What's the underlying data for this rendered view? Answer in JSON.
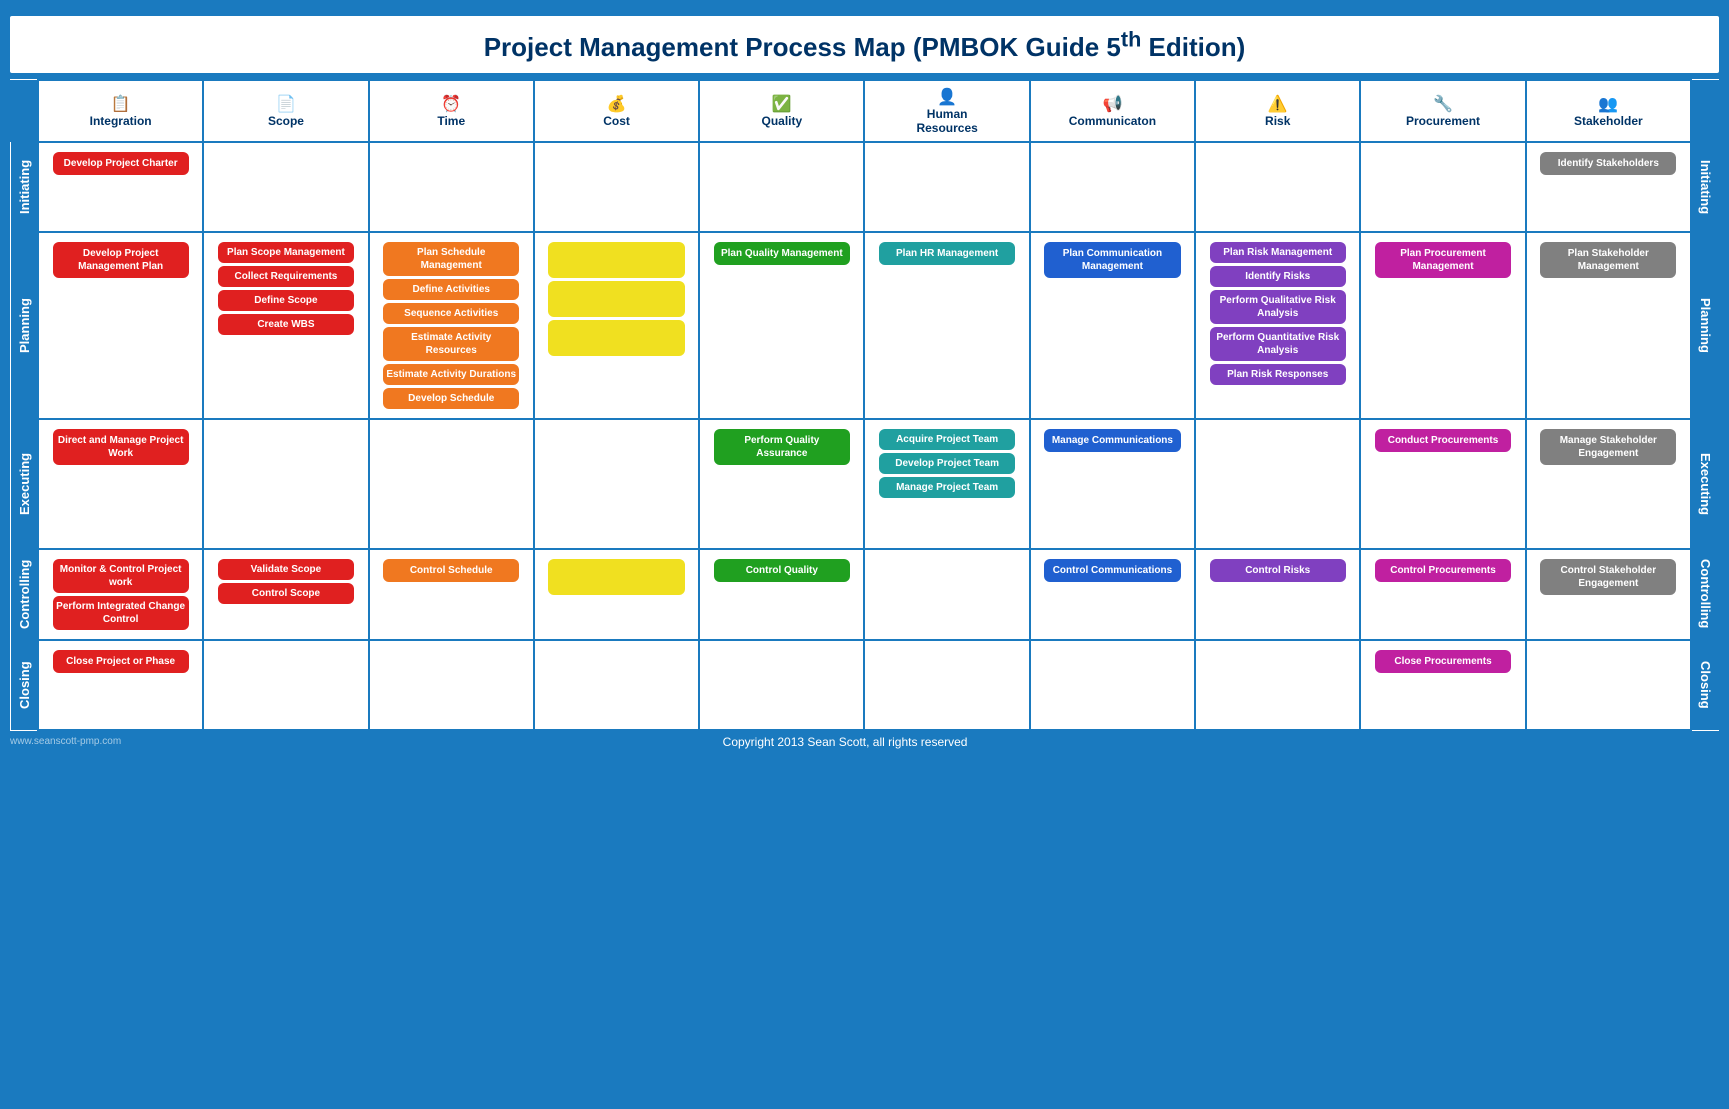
{
  "title": {
    "main": "Project Management Process Map (PMBOK Guide 5",
    "sup": "th",
    "main2": " Edition)"
  },
  "columns": [
    {
      "label": "Integration",
      "icon": "📋"
    },
    {
      "label": "Scope",
      "icon": "📋"
    },
    {
      "label": "Time",
      "icon": "⏰"
    },
    {
      "label": "Cost",
      "icon": "💰"
    },
    {
      "label": "Quality",
      "icon": "✅"
    },
    {
      "label": "Human\nResources",
      "icon": "👤"
    },
    {
      "label": "Communicaton",
      "icon": "📢"
    },
    {
      "label": "Risk",
      "icon": "⚠️"
    },
    {
      "label": "Procurement",
      "icon": "🔧"
    },
    {
      "label": "Stakeholder",
      "icon": "👥"
    }
  ],
  "phases": [
    {
      "name": "Initiating",
      "rows": 1,
      "cells": [
        {
          "col": 0,
          "boxes": [
            {
              "text": "Develop Project Charter",
              "color": "red"
            }
          ]
        },
        {
          "col": 1,
          "boxes": []
        },
        {
          "col": 2,
          "boxes": []
        },
        {
          "col": 3,
          "boxes": []
        },
        {
          "col": 4,
          "boxes": []
        },
        {
          "col": 5,
          "boxes": []
        },
        {
          "col": 6,
          "boxes": []
        },
        {
          "col": 7,
          "boxes": []
        },
        {
          "col": 8,
          "boxes": []
        },
        {
          "col": 9,
          "boxes": [
            {
              "text": "Identify Stakeholders",
              "color": "gray"
            }
          ]
        }
      ]
    },
    {
      "name": "Planning",
      "rows": 6,
      "cells": [
        {
          "col": 0,
          "boxes": [
            {
              "text": "Develop Project Management Plan",
              "color": "red"
            }
          ]
        },
        {
          "col": 1,
          "boxes": [
            {
              "text": "Plan Scope Management",
              "color": "red"
            },
            {
              "text": "Collect Requirements",
              "color": "red"
            },
            {
              "text": "Define Scope",
              "color": "red"
            },
            {
              "text": "Create WBS",
              "color": "red"
            }
          ]
        },
        {
          "col": 2,
          "boxes": [
            {
              "text": "Plan Schedule Management",
              "color": "orange"
            },
            {
              "text": "Define Activities",
              "color": "orange"
            },
            {
              "text": "Sequence Activities",
              "color": "orange"
            },
            {
              "text": "Estimate Activity Resources",
              "color": "orange"
            },
            {
              "text": "Estimate Activity Durations",
              "color": "orange"
            },
            {
              "text": "Develop Schedule",
              "color": "orange"
            }
          ]
        },
        {
          "col": 3,
          "boxes": [
            {
              "text": "",
              "color": "yellow"
            },
            {
              "text": "",
              "color": "yellow"
            },
            {
              "text": "",
              "color": "yellow"
            }
          ]
        },
        {
          "col": 4,
          "boxes": [
            {
              "text": "Plan Quality Management",
              "color": "green"
            }
          ]
        },
        {
          "col": 5,
          "boxes": [
            {
              "text": "Plan HR Management",
              "color": "teal"
            }
          ]
        },
        {
          "col": 6,
          "boxes": [
            {
              "text": "Plan Communication Management",
              "color": "blue"
            }
          ]
        },
        {
          "col": 7,
          "boxes": [
            {
              "text": "Plan Risk Management",
              "color": "purple"
            },
            {
              "text": "Identify Risks",
              "color": "purple"
            },
            {
              "text": "Perform Qualitative Risk Analysis",
              "color": "purple"
            },
            {
              "text": "Perform Quantitative Risk Analysis",
              "color": "purple"
            },
            {
              "text": "Plan Risk Responses",
              "color": "purple"
            }
          ]
        },
        {
          "col": 8,
          "boxes": [
            {
              "text": "Plan Procurement Management",
              "color": "magenta"
            }
          ]
        },
        {
          "col": 9,
          "boxes": [
            {
              "text": "Plan Stakeholder Management",
              "color": "gray"
            }
          ]
        }
      ]
    },
    {
      "name": "Executing",
      "rows": 3,
      "cells": [
        {
          "col": 0,
          "boxes": [
            {
              "text": "Direct and Manage Project Work",
              "color": "red"
            }
          ]
        },
        {
          "col": 1,
          "boxes": []
        },
        {
          "col": 2,
          "boxes": []
        },
        {
          "col": 3,
          "boxes": []
        },
        {
          "col": 4,
          "boxes": [
            {
              "text": "Perform Quality Assurance",
              "color": "green"
            }
          ]
        },
        {
          "col": 5,
          "boxes": [
            {
              "text": "Acquire Project Team",
              "color": "teal"
            },
            {
              "text": "Develop Project Team",
              "color": "teal"
            },
            {
              "text": "Manage Project Team",
              "color": "teal"
            }
          ]
        },
        {
          "col": 6,
          "boxes": [
            {
              "text": "Manage Communications",
              "color": "blue"
            }
          ]
        },
        {
          "col": 7,
          "boxes": []
        },
        {
          "col": 8,
          "boxes": [
            {
              "text": "Conduct Procurements",
              "color": "magenta"
            }
          ]
        },
        {
          "col": 9,
          "boxes": [
            {
              "text": "Manage Stakeholder Engagement",
              "color": "gray"
            }
          ]
        }
      ]
    },
    {
      "name": "Controlling",
      "rows": 2,
      "cells": [
        {
          "col": 0,
          "boxes": [
            {
              "text": "Monitor & Control Project work",
              "color": "red"
            },
            {
              "text": "Perform Integrated Change Control",
              "color": "red"
            }
          ]
        },
        {
          "col": 1,
          "boxes": [
            {
              "text": "Validate Scope",
              "color": "red"
            },
            {
              "text": "Control Scope",
              "color": "red"
            }
          ]
        },
        {
          "col": 2,
          "boxes": [
            {
              "text": "Control Schedule",
              "color": "orange"
            }
          ]
        },
        {
          "col": 3,
          "boxes": [
            {
              "text": "",
              "color": "yellow"
            }
          ]
        },
        {
          "col": 4,
          "boxes": [
            {
              "text": "Control Quality",
              "color": "green"
            }
          ]
        },
        {
          "col": 5,
          "boxes": []
        },
        {
          "col": 6,
          "boxes": [
            {
              "text": "Control Communications",
              "color": "blue"
            }
          ]
        },
        {
          "col": 7,
          "boxes": [
            {
              "text": "Control Risks",
              "color": "purple"
            }
          ]
        },
        {
          "col": 8,
          "boxes": [
            {
              "text": "Control Procurements",
              "color": "magenta"
            }
          ]
        },
        {
          "col": 9,
          "boxes": [
            {
              "text": "Control Stakeholder Engagement",
              "color": "gray"
            }
          ]
        }
      ]
    },
    {
      "name": "Closing",
      "rows": 1,
      "cells": [
        {
          "col": 0,
          "boxes": [
            {
              "text": "Close Project or Phase",
              "color": "red"
            }
          ]
        },
        {
          "col": 1,
          "boxes": []
        },
        {
          "col": 2,
          "boxes": []
        },
        {
          "col": 3,
          "boxes": []
        },
        {
          "col": 4,
          "boxes": []
        },
        {
          "col": 5,
          "boxes": []
        },
        {
          "col": 6,
          "boxes": []
        },
        {
          "col": 7,
          "boxes": []
        },
        {
          "col": 8,
          "boxes": [
            {
              "text": "Close Procurements",
              "color": "magenta"
            }
          ]
        },
        {
          "col": 9,
          "boxes": []
        }
      ]
    }
  ],
  "copyright": "Copyright 2013 Sean Scott, all rights reserved",
  "watermark": "www.seanscott-pmp.com"
}
